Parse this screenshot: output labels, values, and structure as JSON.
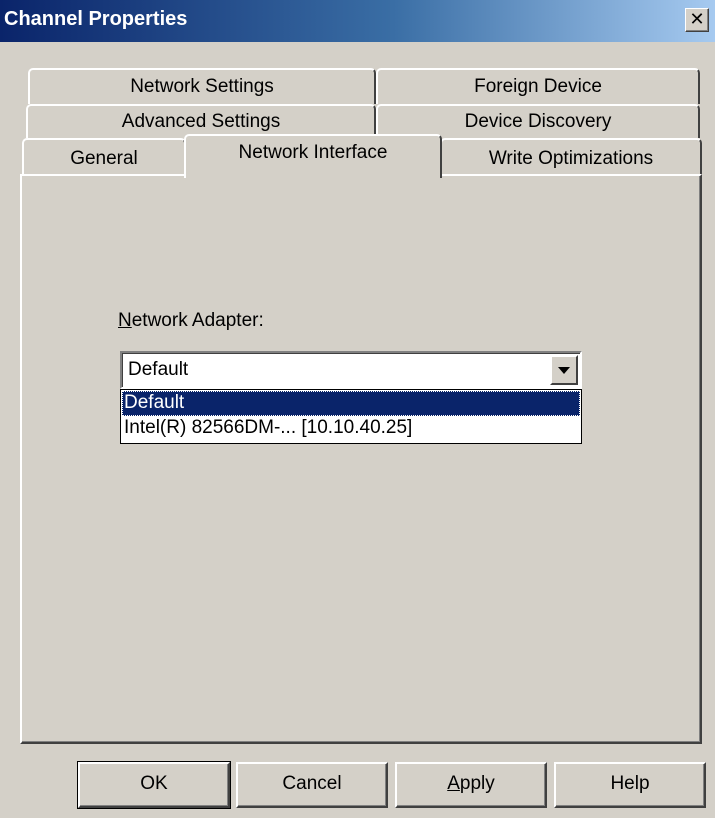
{
  "window": {
    "title": "Channel Properties",
    "close_glyph": "✕"
  },
  "tabs": {
    "row1": [
      {
        "label": "Network Settings"
      },
      {
        "label": "Foreign Device"
      }
    ],
    "row2": [
      {
        "label": "Advanced Settings"
      },
      {
        "label": "Device Discovery"
      }
    ],
    "row3": [
      {
        "label": "General"
      },
      {
        "label": "Network Interface"
      },
      {
        "label": "Write Optimizations"
      }
    ],
    "active": "Network Interface"
  },
  "network_interface": {
    "adapter_label_accel": "N",
    "adapter_label_rest": "etwork Adapter:",
    "selected_value": "Default",
    "dropdown_open": true,
    "options": [
      {
        "label": "Default",
        "selected": true
      },
      {
        "label": "Intel(R) 82566DM-... [10.10.40.25]",
        "selected": false
      }
    ]
  },
  "buttons": {
    "ok": "OK",
    "cancel": "Cancel",
    "apply_accel": "A",
    "apply_rest": "pply",
    "help": "Help"
  }
}
